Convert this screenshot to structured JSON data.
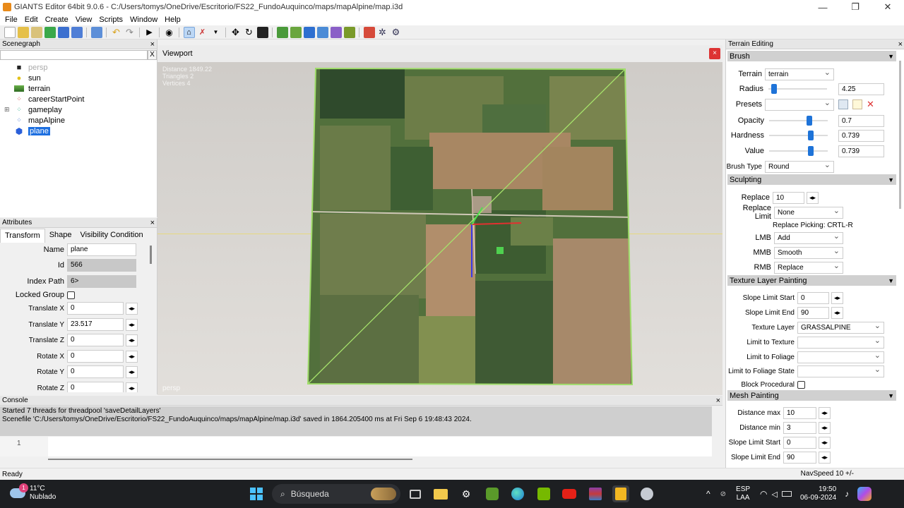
{
  "window": {
    "title": "GIANTS Editor 64bit 9.0.6 - C:/Users/tomys/OneDrive/Escritorio/FS22_FundoAuquinco/maps/mapAlpine/map.i3d",
    "min": "—",
    "max": "❐",
    "close": "✕"
  },
  "menu": [
    "File",
    "Edit",
    "Create",
    "View",
    "Scripts",
    "Window",
    "Help"
  ],
  "scenegraph": {
    "title": "Scenegraph",
    "close": "×",
    "clear": "X",
    "items": [
      {
        "label": "persp",
        "icon": "camera-icon"
      },
      {
        "label": "sun",
        "icon": "lightbulb-icon"
      },
      {
        "label": "terrain",
        "icon": "terrain-icon"
      },
      {
        "label": "careerStartPoint",
        "icon": "transform-group-icon"
      },
      {
        "label": "gameplay",
        "icon": "transform-group-icon",
        "expander": "⊞"
      },
      {
        "label": "mapAlpine",
        "icon": "transform-group-icon"
      },
      {
        "label": "plane",
        "icon": "cube-icon"
      }
    ]
  },
  "attributes": {
    "title": "Attributes",
    "close": "×",
    "tabs": [
      "Transform",
      "Shape",
      "Visibility Condition"
    ],
    "name_label": "Name",
    "name": "plane",
    "id_label": "Id",
    "id": "566",
    "index_label": "Index Path",
    "index": "6>",
    "locked_label": "Locked Group",
    "tx_label": "Translate X",
    "tx": "0",
    "ty_label": "Translate Y",
    "ty": "23.517",
    "tz_label": "Translate Z",
    "tz": "0",
    "rx_label": "Rotate X",
    "rx": "0",
    "ry_label": "Rotate Y",
    "ry": "0",
    "rz_label": "Rotate Z",
    "rz": "0",
    "stepper": "◂▸"
  },
  "viewport": {
    "title": "Viewport",
    "close": "×",
    "stats": [
      "Distance 1849.22",
      "Triangles 2",
      "Vertices 4"
    ],
    "camera": "persp"
  },
  "console": {
    "title": "Console",
    "close": "×",
    "lines": [
      "Started 7 threads for threadpool 'saveDetailLayers'",
      "Scenefile 'C:/Users/tomys/OneDrive/Escritorio/FS22_FundoAuquinco/maps/mapAlpine/map.i3d' saved in 1864.205400 ms at Fri Sep  6 19:48:43 2024."
    ],
    "line_no": "1"
  },
  "status": {
    "ready": "Ready",
    "navspeed": "NavSpeed 10 +/-"
  },
  "terrain": {
    "title": "Terrain Editing",
    "close": "×",
    "brush": {
      "header": "Brush",
      "terrain_label": "Terrain",
      "terrain": "terrain",
      "radius_label": "Radius",
      "radius": "4.25",
      "radius_level": 0.05,
      "presets_label": "Presets",
      "presets": "",
      "opacity_label": "Opacity",
      "opacity": "0.7",
      "opacity_level": 0.7,
      "hardness_label": "Hardness",
      "hardness": "0.739",
      "hardness_level": 0.739,
      "value_label": "Value",
      "value": "0.739",
      "value_level": 0.739,
      "brushtype_label": "Brush Type",
      "brushtype": "Round"
    },
    "sculpting": {
      "header": "Sculpting",
      "replace_label": "Replace",
      "replace": "10",
      "replace_limit_label": "Replace Limit",
      "replace_limit": "None",
      "replace_picking": "Replace Picking: CRTL-R",
      "lmb_label": "LMB",
      "lmb": "Add",
      "mmb_label": "MMB",
      "mmb": "Smooth",
      "rmb_label": "RMB",
      "rmb": "Replace"
    },
    "texture": {
      "header": "Texture Layer Painting",
      "slope_start_label": "Slope Limit Start",
      "slope_start": "0",
      "slope_end_label": "Slope Limit End",
      "slope_end": "90",
      "layer_label": "Texture Layer",
      "layer": "GRASSALPINE",
      "limit_texture_label": "Limit to Texture",
      "limit_texture": "",
      "limit_foliage_label": "Limit to Foliage",
      "limit_foliage": "",
      "limit_foliage_state_label": "Limit to Foliage State",
      "limit_foliage_state": "",
      "block_label": "Block Procedural"
    },
    "mesh": {
      "header": "Mesh Painting",
      "dmax_label": "Distance max",
      "dmax": "10",
      "dmin_label": "Distance min",
      "dmin": "3",
      "sstart_label": "Slope Limit Start",
      "sstart": "0",
      "send_label": "Slope Limit End",
      "send": "90"
    },
    "collapse": "▼",
    "stepper": "◂▸"
  },
  "taskbar": {
    "temp": "11°C",
    "weather": "Nublado",
    "badge": "1",
    "search": "Búsqueda",
    "lang": "ESP",
    "layout": "LAA",
    "time": "19:50",
    "date": "06-09-2024",
    "chevron": "^"
  },
  "colors": {
    "accent": "#1e73d8",
    "selection": "#1d6fe0",
    "close": "#d33333"
  }
}
